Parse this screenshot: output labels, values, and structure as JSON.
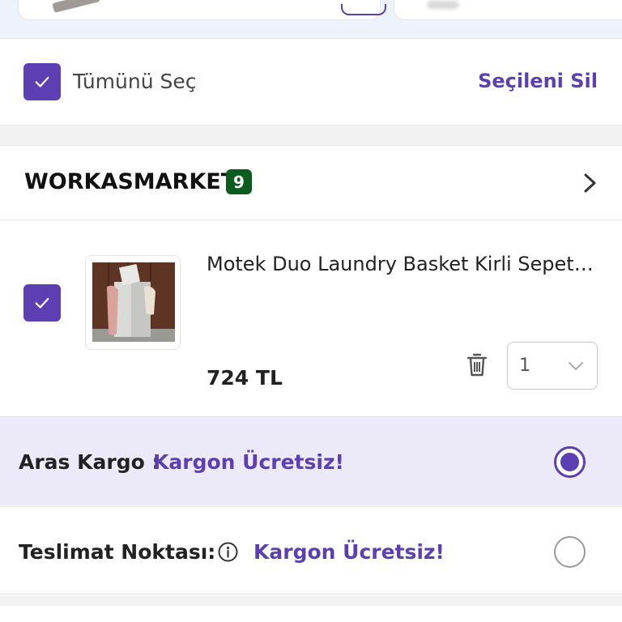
{
  "select_all": {
    "checked": true,
    "label": "Tümünü Seç",
    "delete_label": "Seçileni Sil"
  },
  "seller": {
    "name": "WORKASMARKET",
    "count": "9"
  },
  "product": {
    "checked": true,
    "title": "Motek Duo Laundry Basket Kirli Sepeti ...",
    "price": "724 TL",
    "quantity": "1"
  },
  "shipping": [
    {
      "label": "Aras Kargo :",
      "free_label": "Kargon Ücretsiz!",
      "selected": true
    },
    {
      "label": "Teslimat Noktası:",
      "free_label": "Kargon Ücretsiz!",
      "selected": false
    }
  ],
  "colors": {
    "accent": "#5b3fb3",
    "badge": "#0d5c1f",
    "selected_bg": "#ece9f8"
  },
  "icons": [
    "check-icon",
    "chevron-right-icon",
    "trash-icon",
    "chevron-down-icon",
    "info-icon"
  ]
}
